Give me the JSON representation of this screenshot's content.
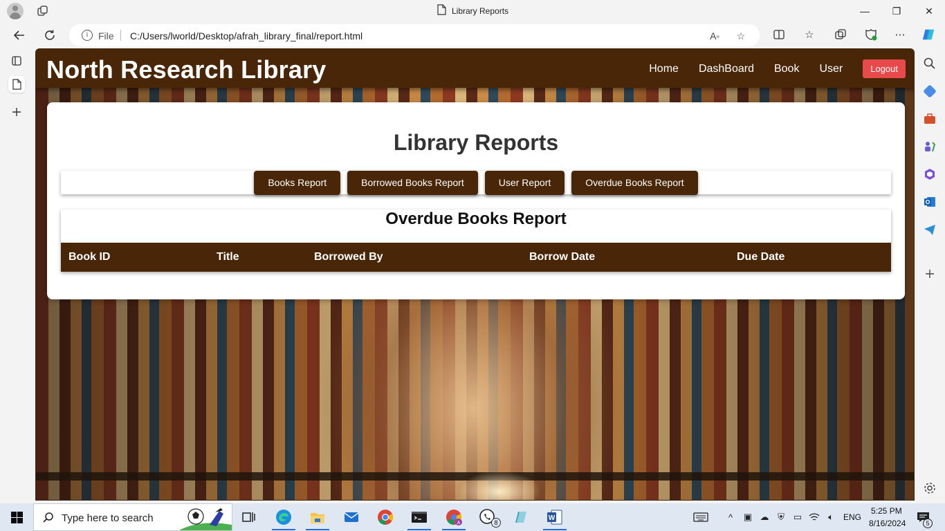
{
  "browser": {
    "tab_title": "Library Reports",
    "address_scheme": "File",
    "address_url": "C:/Users/lworld/Desktop/afrah_library_final/report.html",
    "window_controls": {
      "minimize": "—",
      "restore": "❐",
      "close": "✕"
    }
  },
  "site": {
    "brand": "North Research Library",
    "nav": [
      {
        "label": "Home"
      },
      {
        "label": "DashBoard"
      },
      {
        "label": "Book"
      },
      {
        "label": "User"
      }
    ],
    "logout_label": "Logout",
    "accent_color": "#4a2608",
    "logout_color": "#e8494b"
  },
  "page": {
    "title": "Library Reports",
    "report_buttons": [
      {
        "label": "Books Report"
      },
      {
        "label": "Borrowed Books Report"
      },
      {
        "label": "User Report"
      },
      {
        "label": "Overdue Books Report"
      }
    ],
    "report": {
      "title": "Overdue Books Report",
      "columns": [
        "Book ID",
        "Title",
        "Borrowed By",
        "Borrow Date",
        "Due Date"
      ],
      "rows": []
    }
  },
  "taskbar": {
    "search_placeholder": "Type here to search",
    "whatsapp_badge": "8",
    "language": "ENG",
    "time": "5:25 PM",
    "date": "8/16/2024",
    "notification_count": "5"
  }
}
